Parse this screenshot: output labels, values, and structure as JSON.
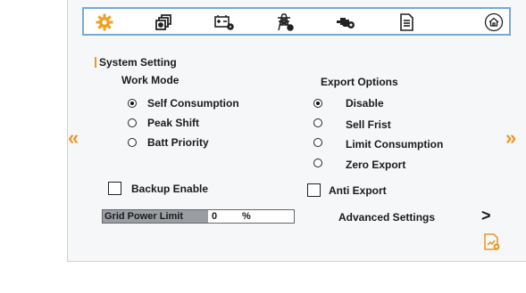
{
  "toolbar": {
    "icons": [
      "gear-icon",
      "stack-icon",
      "battery-settings-icon",
      "grid-tower-icon",
      "generator-icon",
      "document-icon",
      "home-icon"
    ]
  },
  "section_title": "System Setting",
  "work_mode": {
    "title": "Work Mode",
    "options": [
      {
        "label": "Self Consumption",
        "selected": true
      },
      {
        "label": "Peak Shift",
        "selected": false
      },
      {
        "label": "Batt Priority",
        "selected": false
      }
    ]
  },
  "export_options": {
    "title": "Export Options",
    "options": [
      {
        "label": "Disable",
        "selected": true
      },
      {
        "label": "Sell Frist",
        "selected": false
      },
      {
        "label": "Limit Consumption",
        "selected": false
      },
      {
        "label": "Zero Export",
        "selected": false
      }
    ]
  },
  "backup_enable": {
    "label": "Backup Enable",
    "checked": false
  },
  "anti_export": {
    "label": "Anti Export",
    "checked": false
  },
  "grid_power_limit": {
    "label": "Grid Power Limit",
    "value": "0",
    "unit": "%"
  },
  "advanced_settings": {
    "label": "Advanced Settings",
    "arrow": ">"
  },
  "nav": {
    "prev": "«",
    "next": "»"
  },
  "colors": {
    "accent": "#e99a2a",
    "topbar_border": "#78a8d8",
    "label_bg": "#9a9ea3"
  }
}
